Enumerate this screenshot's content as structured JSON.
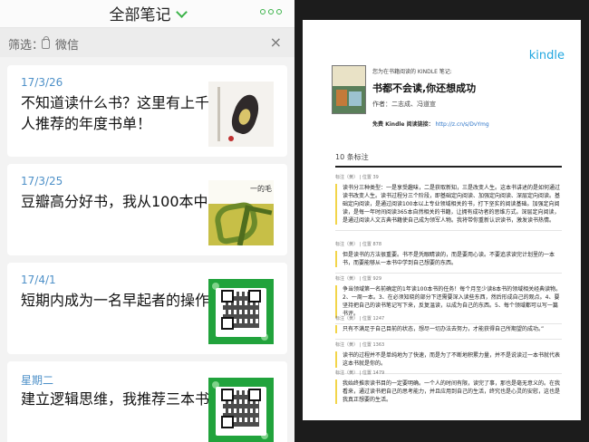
{
  "left": {
    "header": {
      "title": "全部笔记",
      "menu_icon": "more-dots-icon",
      "accent": "#3cb34a"
    },
    "filter": {
      "label": "筛选：",
      "source": "微信",
      "clear": "×"
    },
    "notes": [
      {
        "date": "17/3/26",
        "title": "不知道读什么书？这里有上千人推荐的年度书单！",
        "thumb": "book-cover-bird"
      },
      {
        "date": "17/3/25",
        "title": "豆瓣高分好书，我从100本中",
        "thumb": "book-cover-calligraphy",
        "thumb_text": "一的毛"
      },
      {
        "date": "17/4/1",
        "title": "短期内成为一名早起者的操作",
        "thumb": "wechat-qr-code"
      },
      {
        "date": "星期二",
        "title": "建立逻辑思维，我推荐三本书",
        "thumb": "wechat-qr-code"
      }
    ]
  },
  "right": {
    "brand": "kindle",
    "book": {
      "export_note": "您为在书籍阅读的 KINDLE 笔记:",
      "title": "书都不会读,你还想成功",
      "author": "作者：二志成、冯道宣",
      "free_label": "免费 Kindle 阅读链接：",
      "free_link": "http://z.cn/s/DvYmg"
    },
    "count": "10 条标注",
    "highlights": [
      {
        "caption": "标注（黄） | 位置 39",
        "text": "读书分三种类型：一是享受趣味，二是获取新知，三是改变人生。这本书讲述的是如何通过读书改变人生。读书过程分三个阶段，即基础定向阅读、加强定向阅读、深层定向阅读。基础定向阅读，是通过阅读100本以上专业领域相关的书，打下坚实的阅读基础。加强定向阅读，是每一年时间阅读365本自然相关的书籍，让拥有成功者的思维方式。深层定向阅读，是通过阅读人文古典书籍使自己成为领军人物。我将带你重新认识读书，激发读书热情。"
      },
      {
        "caption": "标注（黄） | 位置 878",
        "text": "但是读书的方法很重要。书不是凭眼睛读的，而是要用心读。不要追求读完计划里的一本书，而要能够从一本书中学到自己想要的东西。"
      },
      {
        "caption": "标注（黄） | 位置 929",
        "text": "争当领域第一名前确定的1年读100本书的任务！每个月至少读8本书的领域相关经典读物。2、一周一本。3、在必须知晓的部分下还需要深入读些东西，然后形成自己的观点。4、要坚持把自己的读书笔记写下来，反复温读，以成为自己的东西。5、每个领域都可以写一篇书评。"
      },
      {
        "caption": "标注（黄） | 位置 1247",
        "text": "只有不满足于自己目前的状态，想尽一切办法去努力，才能获得自己所期望的成功。”"
      },
      {
        "caption": "标注（黄） | 位置 1363",
        "text": "读书的过程并不是单纯地为了快速，而是为了不断地积累力量，并不是说读过一本书就代表这本书就是你的。"
      },
      {
        "caption": "标注（黄） | 位置 1479",
        "text": "我始终推崇读书目的一定要明确。一个人的时间有限，读完了事，那也是毫无意义的。在我看来，通过读书把自己的思考能力，并且应用到自己的生活，终究也是心灵的安慰，这也是我真正想要的生活。"
      }
    ]
  }
}
